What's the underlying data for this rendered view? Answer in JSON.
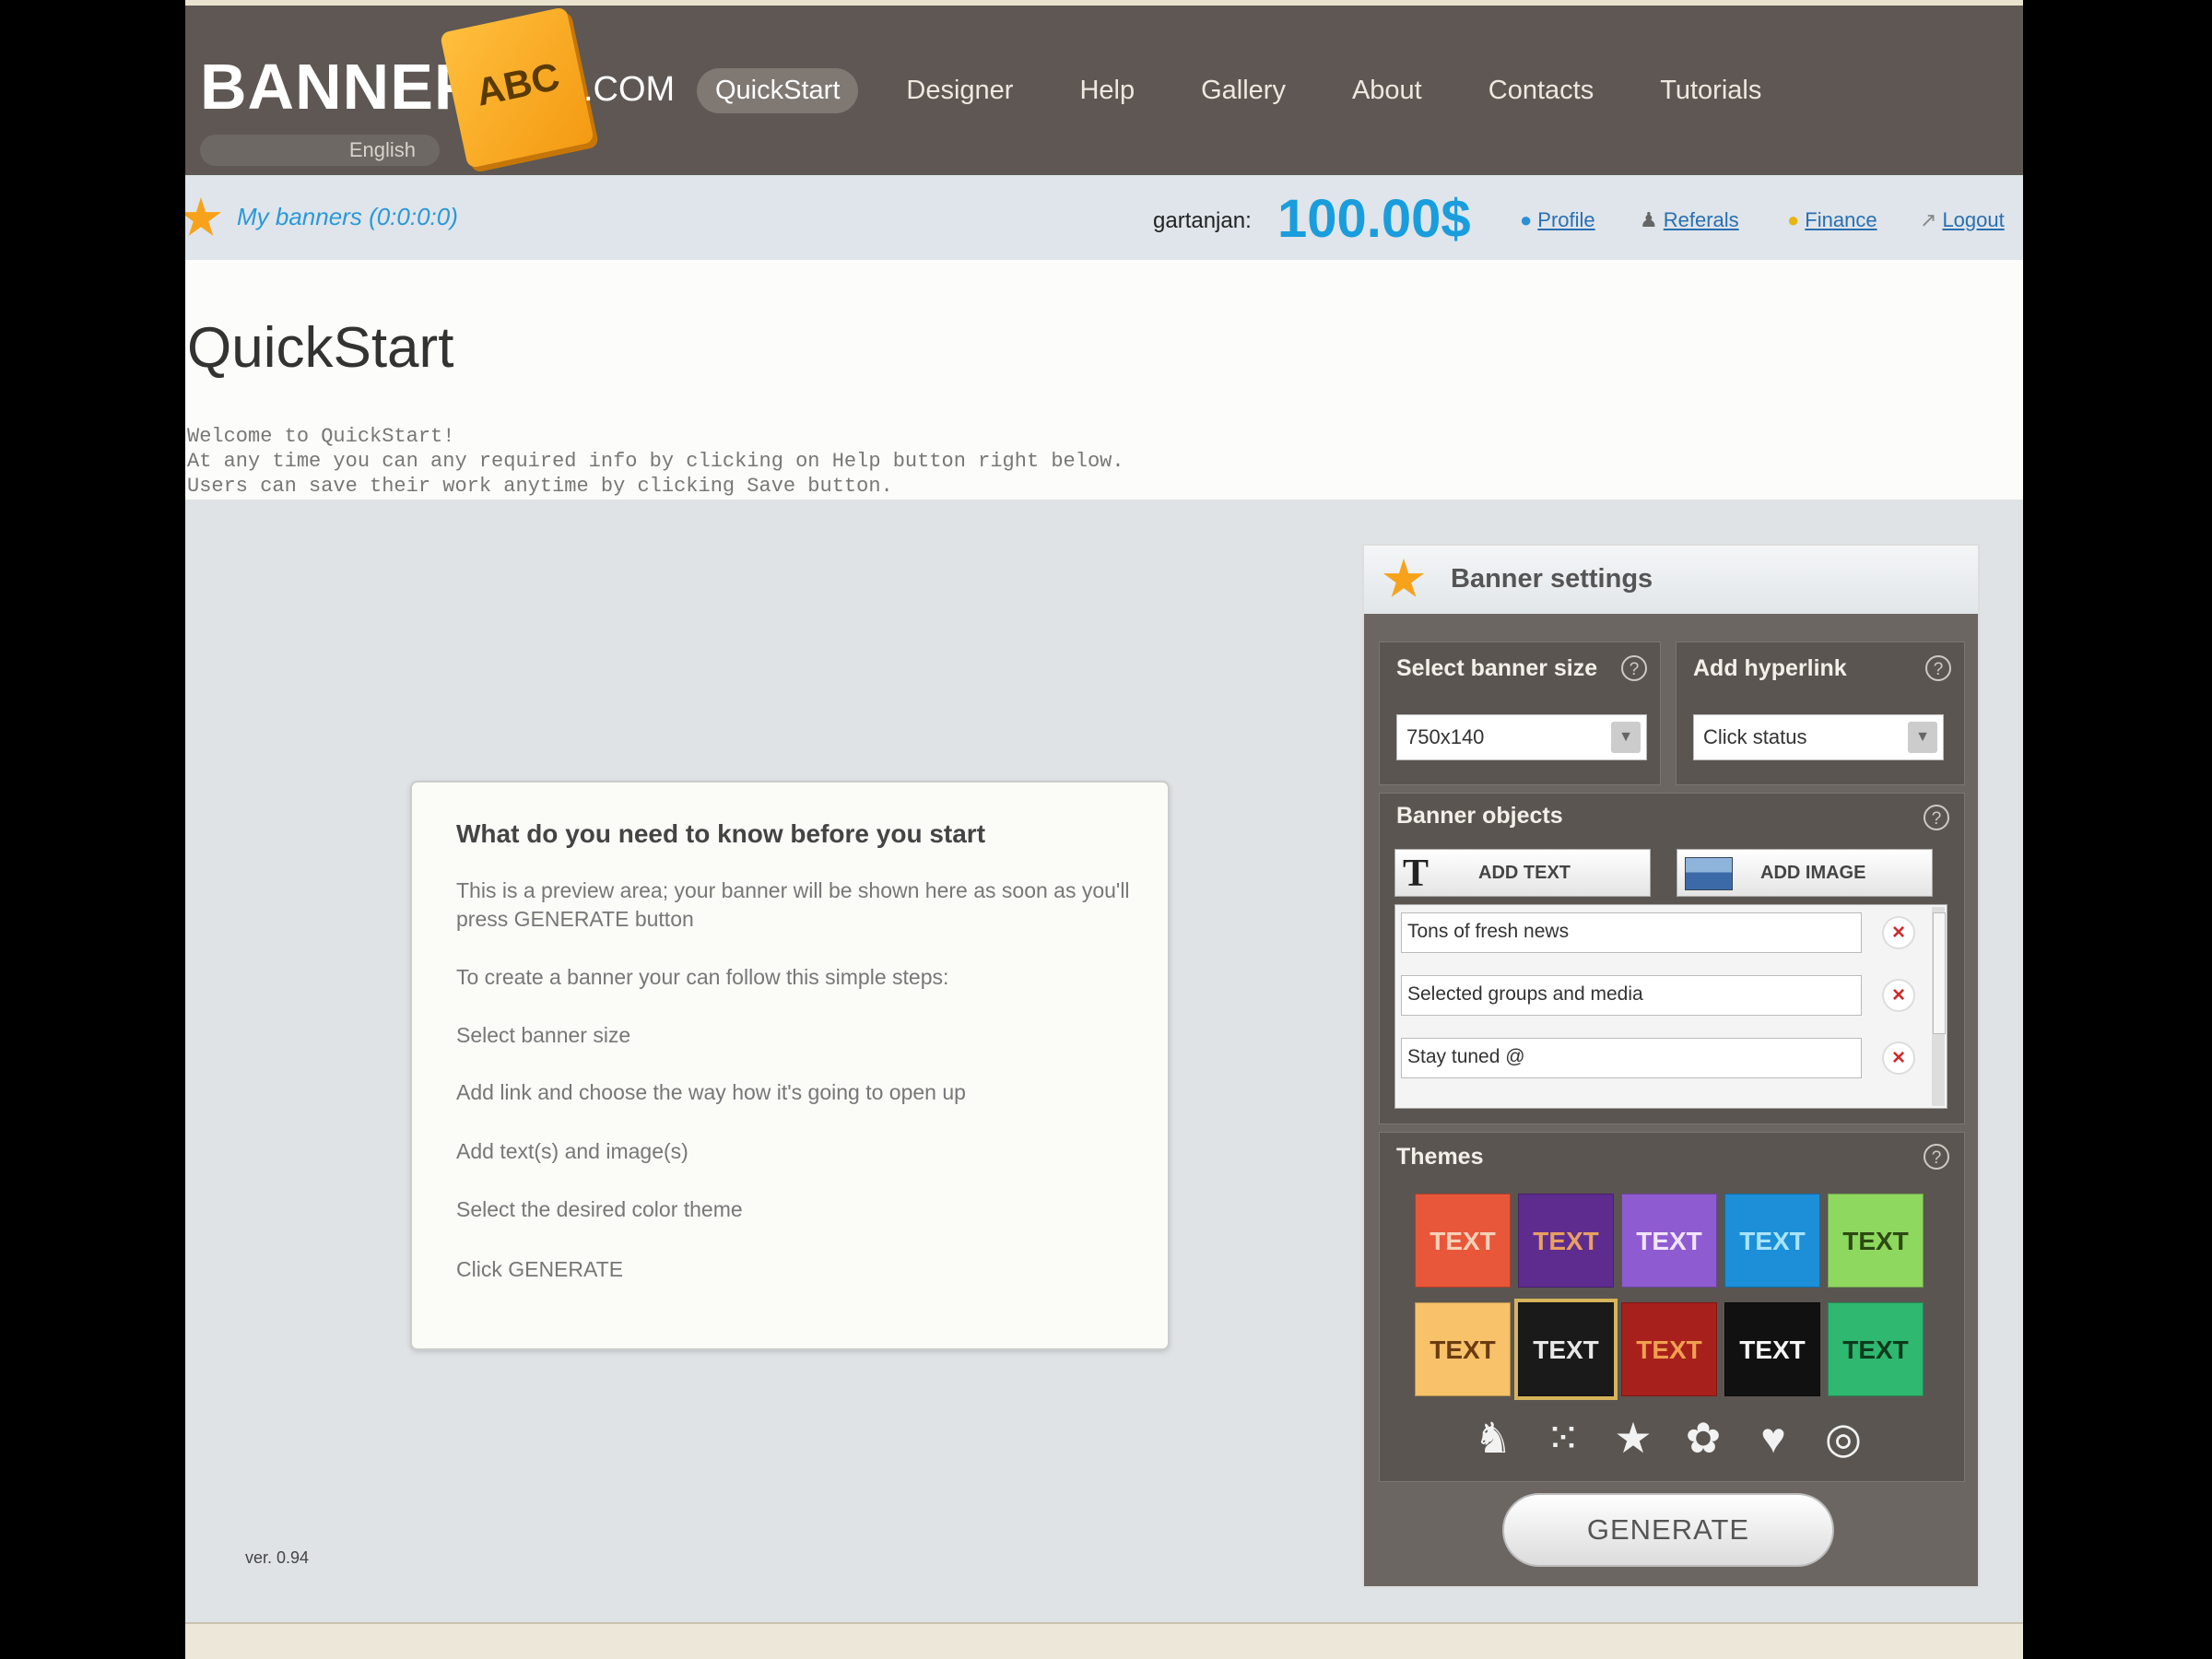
{
  "brand": {
    "name": "BANNERS",
    "badge": "ABC",
    "suffix": ".COM"
  },
  "language": "English",
  "nav": [
    {
      "label": "QuickStart",
      "active": true
    },
    {
      "label": "Designer"
    },
    {
      "label": "Help"
    },
    {
      "label": "Gallery"
    },
    {
      "label": "About"
    },
    {
      "label": "Contacts"
    },
    {
      "label": "Tutorials"
    }
  ],
  "account": {
    "my_banners": "My banners (0:0:0:0)",
    "username": "gartanjan:",
    "balance": "100.00$",
    "links": [
      {
        "label": "Profile",
        "icon": "info-icon"
      },
      {
        "label": "Referals",
        "icon": "user-icon"
      },
      {
        "label": "Finance",
        "icon": "coin-icon"
      },
      {
        "label": "Logout",
        "icon": "logout-icon"
      }
    ]
  },
  "page": {
    "title": "QuickStart",
    "intro": [
      "Welcome to QuickStart!",
      "At any time you can any required info by clicking on Help button right below.",
      "Users can save their work anytime by clicking Save button."
    ]
  },
  "infobox": {
    "heading": "What do you need to know before you start",
    "lines": [
      "This is a preview area; your banner will be shown here as soon as you'll press GENERATE button",
      "To create a banner your can follow this simple steps:",
      "Select banner size",
      "Add link and choose the way how it's going to open up",
      "Add text(s) and image(s)",
      "Select the desired color theme",
      "Click GENERATE"
    ]
  },
  "version": "ver. 0.94",
  "settings": {
    "title": "Banner settings",
    "size_label": "Select banner size",
    "size_value": "750x140",
    "hyperlink_label": "Add hyperlink",
    "hyperlink_value": "Click status",
    "objects_label": "Banner objects",
    "add_text": "ADD TEXT",
    "add_image": "ADD IMAGE",
    "objects": [
      "Tons of fresh news",
      "Selected groups and media",
      "Stay tuned @"
    ],
    "themes_label": "Themes",
    "theme_text": "TEXT",
    "themes": [
      {
        "bg": "#e8573a",
        "fg": "#f7d0b8"
      },
      {
        "bg": "#5e2c8f",
        "fg": "#e8a060"
      },
      {
        "bg": "#8f5bd0",
        "fg": "#f0e4ff"
      },
      {
        "bg": "#1c8fd8",
        "fg": "#a8e4ff"
      },
      {
        "bg": "#8fd860",
        "fg": "#2c4a10"
      },
      {
        "bg": "#f7c26a",
        "fg": "#6a3c10"
      },
      {
        "bg": "#1a1a1a",
        "fg": "#e8e8e8",
        "selected": true
      },
      {
        "bg": "#a8201c",
        "fg": "#f0a050"
      },
      {
        "bg": "#111111",
        "fg": "#f5f5f5"
      },
      {
        "bg": "#2fb870",
        "fg": "#0c3a1c"
      }
    ],
    "shape_icons": [
      "figures-icon",
      "dots-icon",
      "star-icon",
      "flower-icon",
      "heart-icon",
      "circles-icon"
    ],
    "generate": "GENERATE"
  },
  "colors": {
    "accent": "#1a9ddc",
    "nav_bg": "#5e5753",
    "panel_bg": "#6c6662"
  }
}
